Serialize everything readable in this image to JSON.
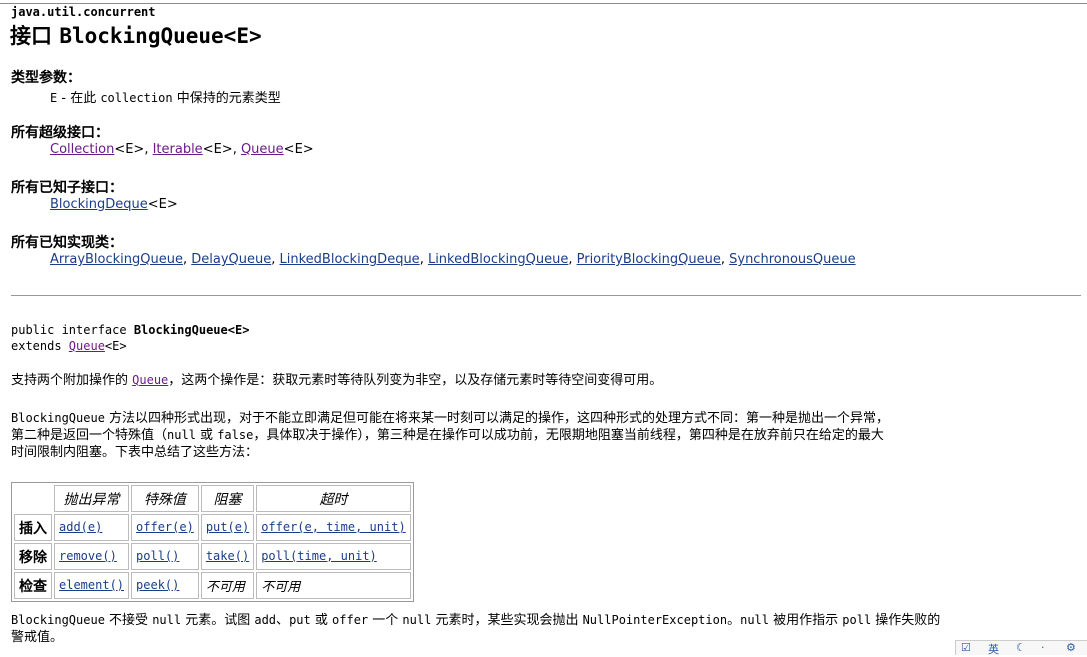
{
  "package": "java.util.concurrent",
  "title": {
    "prefix": "接口",
    "name": "BlockingQueue<E>"
  },
  "type_params": {
    "heading": "类型参数：",
    "param": "E",
    "dash": " - 在此 ",
    "code": "collection",
    "desc": " 中保持的元素类型"
  },
  "superinterfaces": {
    "heading": "所有超级接口：",
    "items": [
      {
        "name": "Collection",
        "generic": "<E>"
      },
      {
        "name": "Iterable",
        "generic": "<E>"
      },
      {
        "name": "Queue",
        "generic": "<E>"
      }
    ]
  },
  "subinterfaces": {
    "heading": "所有已知子接口：",
    "items": [
      {
        "name": "BlockingDeque",
        "generic": "<E>"
      }
    ]
  },
  "implementing": {
    "heading": "所有已知实现类：",
    "items": [
      "ArrayBlockingQueue",
      "DelayQueue",
      "LinkedBlockingDeque",
      "LinkedBlockingQueue",
      "PriorityBlockingQueue",
      "SynchronousQueue"
    ]
  },
  "declaration": {
    "line1_prefix": "public interface ",
    "line1_name": "BlockingQueue<E>",
    "line2_prefix": "extends ",
    "line2_link": "Queue",
    "line2_suffix": "<E>"
  },
  "para1": {
    "before": "支持两个附加操作的 ",
    "link": "Queue",
    "after": "，这两个操作是：获取元素时等待队列变为非空，以及存储元素时等待空间变得可用。"
  },
  "para2": {
    "code": "BlockingQueue",
    "line1": " 方法以四种形式出现，对于不能立即满足但可能在将来某一时刻可以满足的操作，这四种形式的处理方式不同：第一种是抛出一个异常，",
    "line2a": "第二种是返回一个特殊值（",
    "null": "null",
    "or": " 或 ",
    "false": "false",
    "line2b": "，具体取决于操作），第三种是在操作可以成功前，无限期地阻塞当前线程，第四种是在放弃前只在给定的最大",
    "line3": "时间限制内阻塞。下表中总结了这些方法："
  },
  "table": {
    "headers": [
      "抛出异常",
      "特殊值",
      "阻塞",
      "超时"
    ],
    "rows": [
      {
        "label": "插入",
        "cells": [
          "add(e)",
          "offer(e)",
          "put(e)",
          "offer(e, time, unit)"
        ]
      },
      {
        "label": "移除",
        "cells": [
          "remove()",
          "poll()",
          "take()",
          "poll(time, unit)"
        ]
      },
      {
        "label": "检查",
        "cells": [
          "element()",
          "peek()",
          "不可用",
          "不可用"
        ]
      }
    ]
  },
  "para3": {
    "c1": "BlockingQueue",
    "t1": " 不接受 ",
    "c2": "null",
    "t2": " 元素。试图 ",
    "c3": "add",
    "t3": "、",
    "c4": "put",
    "t4": " 或 ",
    "c5": "offer",
    "t5": " 一个 ",
    "c6": "null",
    "t6": " 元素时，某些实现会抛出 ",
    "c7": "NullPointerException",
    "t7": "。",
    "c8": "null",
    "t8": " 被用作指示 ",
    "c9": "poll",
    "t9": " 操作失败的",
    "line2": "警戒值。"
  },
  "tray": {
    "text": "英"
  }
}
